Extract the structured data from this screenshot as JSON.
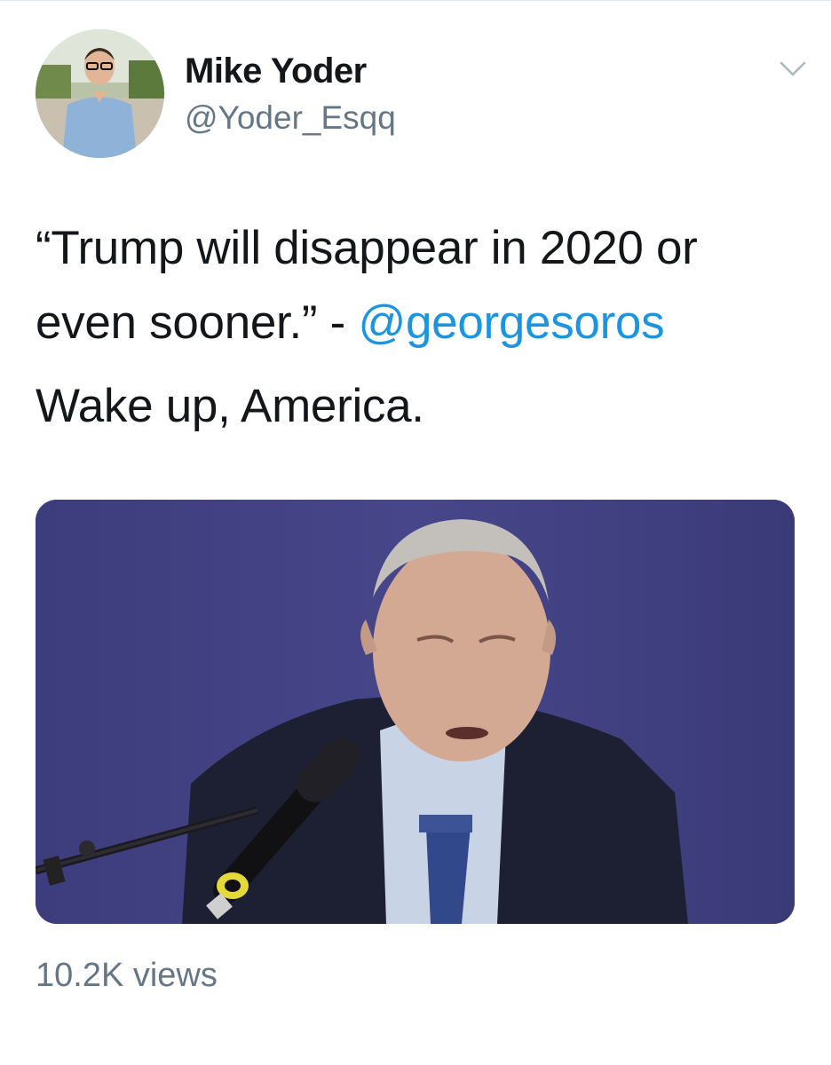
{
  "tweet": {
    "author": {
      "name": "Mike Yoder",
      "handle": "@Yoder_Esqq",
      "avatar_icon": "profile-photo"
    },
    "menu_icon": "chevron-down-icon",
    "text": {
      "line1_part1": "“Trump will disappear in 2020 or even sooner.” - ",
      "mention": "@georgesoros",
      "line2": "Wake up, America."
    },
    "media": {
      "type": "video",
      "description_icon": "video-thumbnail"
    },
    "views": "10.2K views"
  },
  "colors": {
    "text_primary": "#14171a",
    "text_secondary": "#657786",
    "link": "#1b95e0",
    "media_background": "#3f3e80"
  }
}
